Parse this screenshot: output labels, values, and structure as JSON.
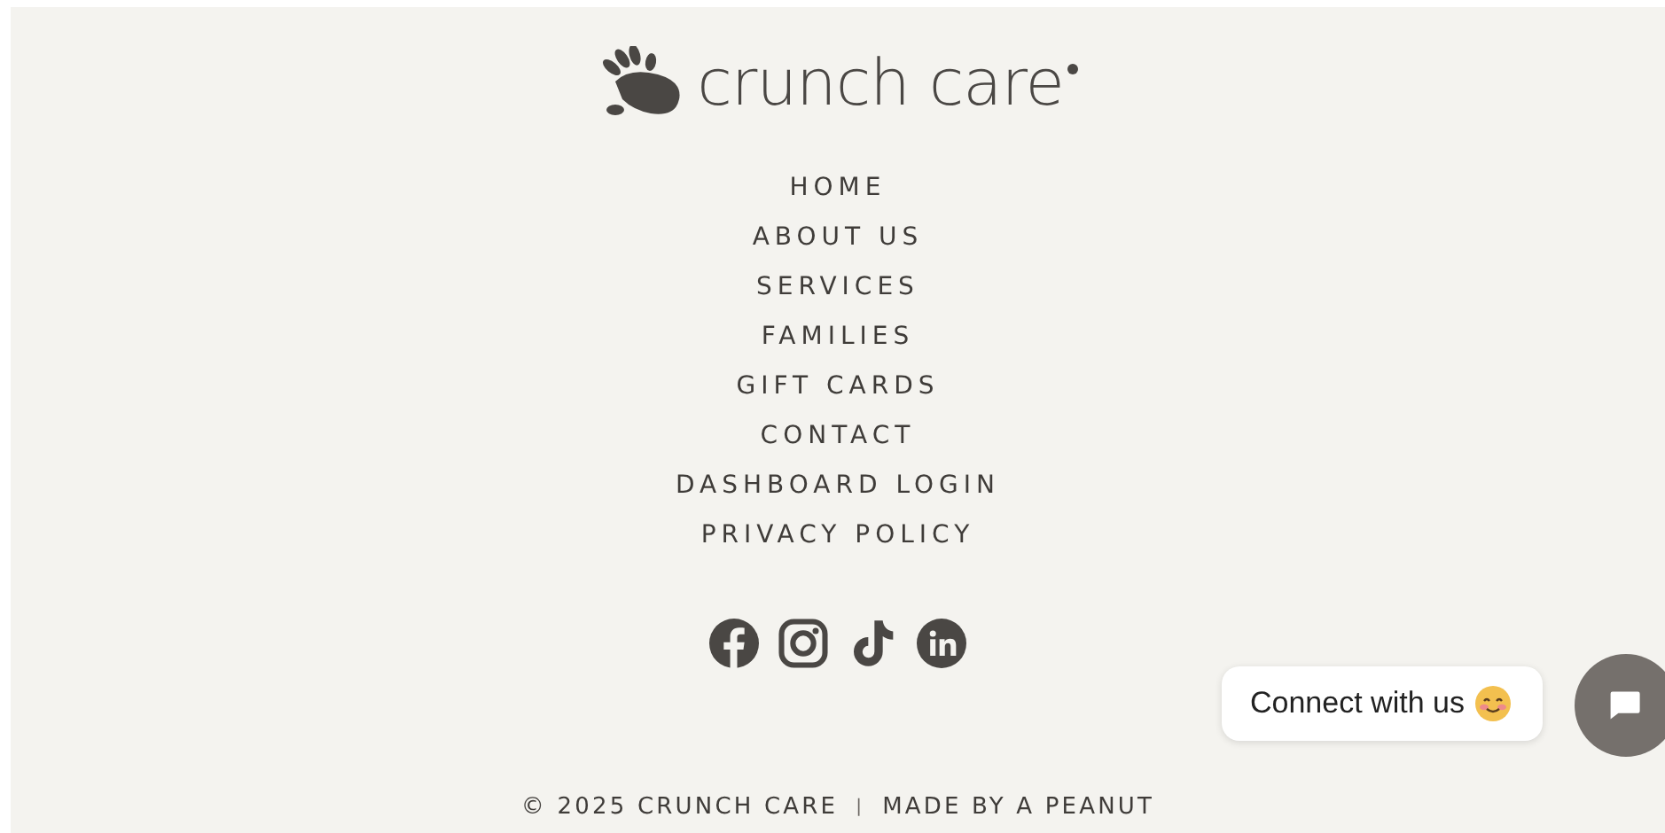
{
  "logo": {
    "text": "crunch care"
  },
  "nav": [
    "HOME",
    "ABOUT US",
    "SERVICES",
    "FAMILIES",
    "GIFT CARDS",
    "CONTACT",
    "DASHBOARD LOGIN",
    "PRIVACY POLICY"
  ],
  "social": [
    {
      "kind": "facebook"
    },
    {
      "kind": "instagram"
    },
    {
      "kind": "tiktok"
    },
    {
      "kind": "linkedin"
    }
  ],
  "chat": {
    "label": "Connect with us"
  },
  "footer": {
    "copyright": "© 2025 CRUNCH CARE",
    "separator": "|",
    "credit": "MADE BY A PEANUT"
  }
}
